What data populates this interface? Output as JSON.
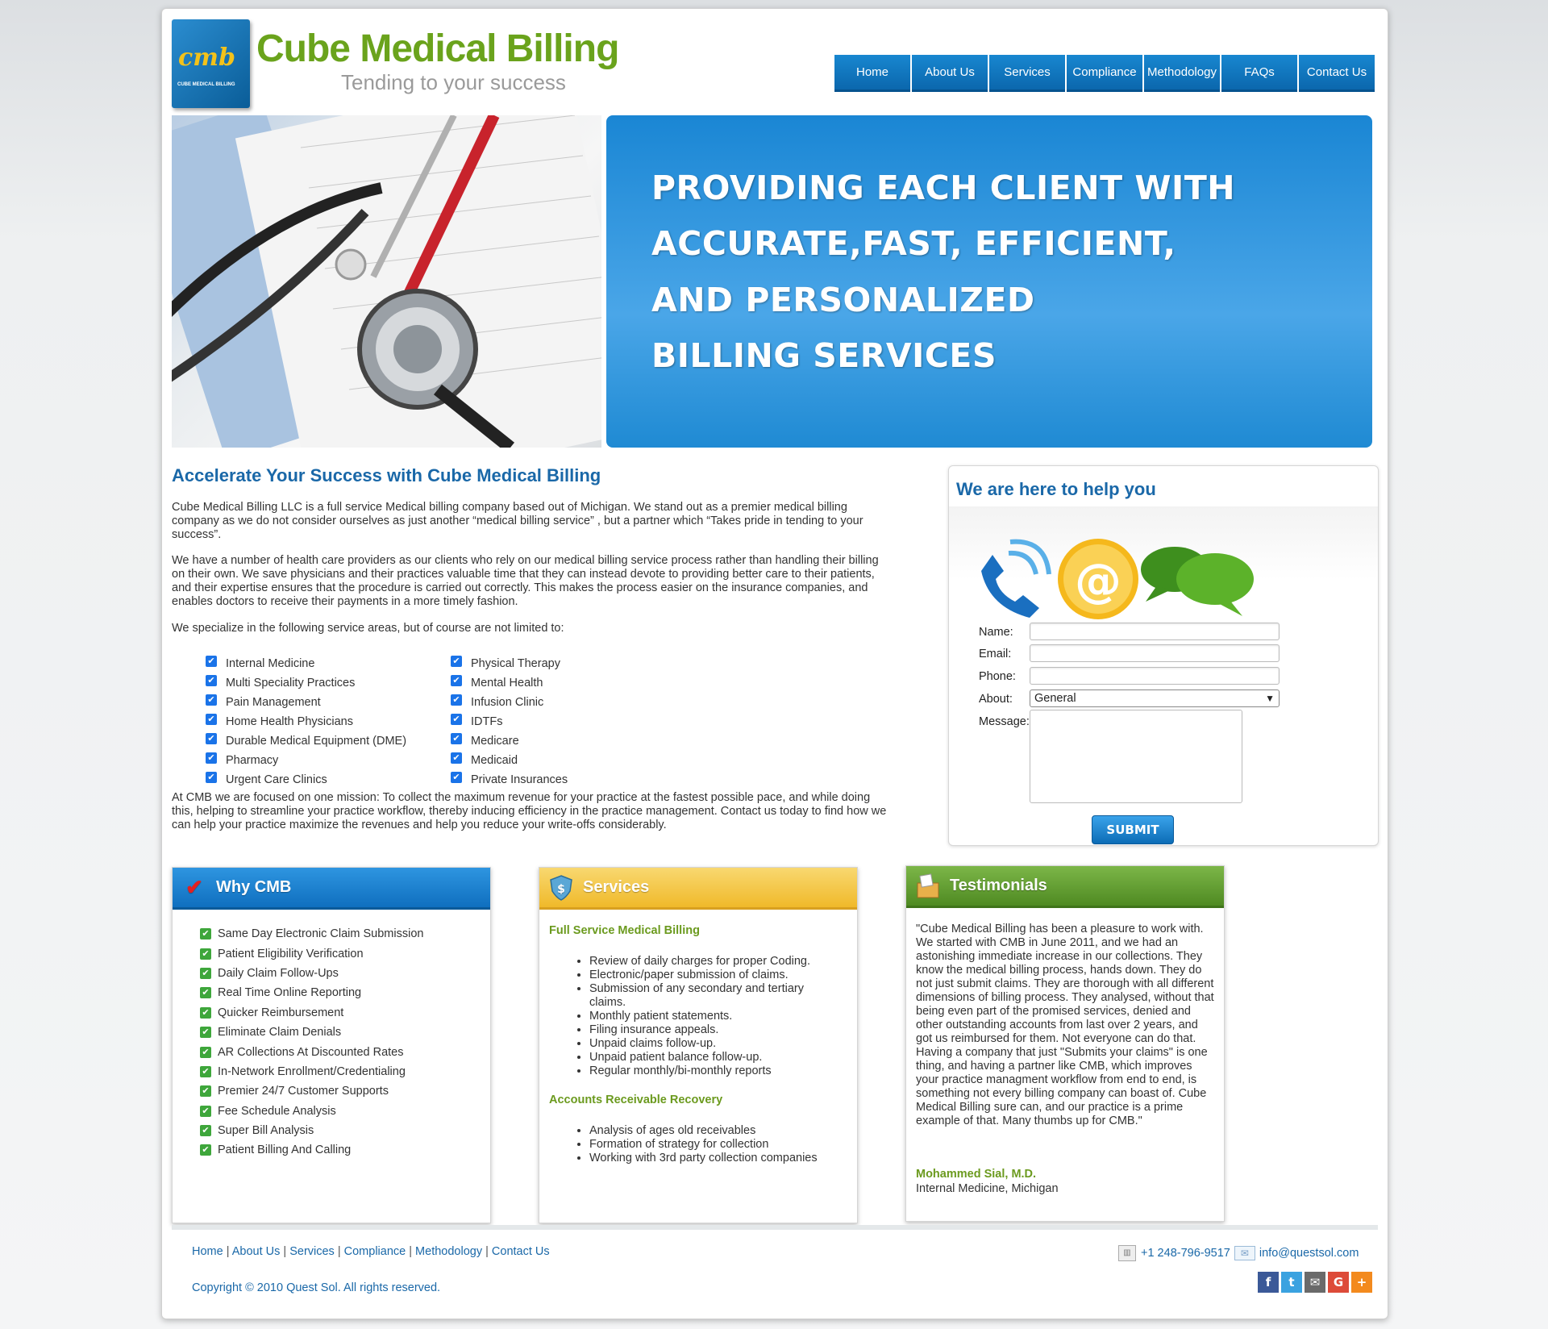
{
  "header": {
    "logo_text": "cmb",
    "logo_subtext": "CUBE MEDICAL BILLING",
    "brand": "Cube Medical Billing",
    "tagline": "Tending to your success"
  },
  "nav": [
    "Home",
    "About Us",
    "Services",
    "Compliance",
    "Methodology",
    "FAQs",
    "Contact Us"
  ],
  "hero": {
    "lines": [
      "PROVIDING EACH CLIENT WITH",
      "ACCURATE,FAST, EFFICIENT,",
      "AND PERSONALIZED",
      "BILLING SERVICES"
    ]
  },
  "main": {
    "title": "Accelerate Your Success with Cube Medical Billing",
    "p1": "Cube Medical Billing LLC is a full service Medical billing company based out of Michigan. We stand out as a premier medical billing company as we do not consider ourselves as just another “medical billing service” , but a partner which “Takes pride in tending to your success”.",
    "p2": "We have a number of health care providers as our clients who rely on our medical billing service process rather than handling their billing on their own. We save physicians and their practices valuable time that they can instead devote to providing better care to their patients, and their expertise ensures that the procedure is carried out correctly. This makes the process easier on the insurance companies, and enables doctors to receive their payments in a more timely fashion.",
    "p3": "We specialize in the following service areas, but of course are not limited to:",
    "areas_left": [
      "Internal Medicine",
      "Multi Speciality Practices",
      "Pain Management",
      "Home Health Physicians",
      "Durable Medical Equipment (DME)",
      "Pharmacy",
      "Urgent Care Clinics"
    ],
    "areas_right": [
      "Physical Therapy",
      "Mental Health",
      "Infusion Clinic",
      "IDTFs",
      "Medicare",
      "Medicaid",
      "Private Insurances"
    ],
    "p4": "At CMB we are focused on one mission: To collect the maximum revenue for your practice at the fastest possible pace, and while doing this, helping to streamline your practice workflow, thereby inducing efficiency in the practice management. Contact us today to find how we can help your practice maximize the revenues and help you reduce your write-offs considerably."
  },
  "contact": {
    "title": "We are here to help you",
    "name_label": "Name:",
    "email_label": "Email:",
    "phone_label": "Phone:",
    "about_label": "About:",
    "about_value": "General",
    "message_label": "Message:",
    "submit": "SUBMIT"
  },
  "why": {
    "title": "Why CMB",
    "items": [
      "Same Day Electronic Claim Submission",
      "Patient Eligibility Verification",
      "Daily Claim Follow-Ups",
      "Real Time Online Reporting",
      "Quicker Reimbursement",
      "Eliminate Claim Denials",
      "AR Collections At Discounted Rates",
      "In-Network Enrollment/Credentialing",
      "Premier 24/7 Customer Supports",
      "Fee Schedule Analysis",
      "Super Bill Analysis",
      "Patient Billing And Calling"
    ]
  },
  "services": {
    "title": "Services",
    "h1": "Full Service Medical Billing",
    "list1": [
      "Review of daily charges for proper Coding.",
      "Electronic/paper submission of claims.",
      "Submission of any secondary and tertiary claims.",
      "Monthly patient statements.",
      "Filing insurance appeals.",
      "Unpaid claims follow-up.",
      "Unpaid patient balance follow-up.",
      "Regular monthly/bi-monthly reports"
    ],
    "h2": "Accounts Receivable Recovery",
    "list2": [
      "Analysis of ages old receivables",
      "Formation of strategy for collection",
      "Working with 3rd party collection companies"
    ]
  },
  "testimonials": {
    "title": "Testimonials",
    "text": "\"Cube Medical Billing has been a pleasure to work with. We started with CMB in June 2011, and we had an astonishing immediate increase in our collections. They know the medical billing process, hands down. They do not just submit claims. They are thorough with all different dimensions of billing process. They analysed, without that being even part of the promised services, denied and other outstanding accounts from last over 2 years, and got us reimbursed for them. Not everyone can do that. Having a company that just \"Submits your claims\" is one thing, and having a partner like CMB, which improves your practice managment workflow from end to end, is something not every billing company can boast of. Cube Medical Billing sure can, and our practice is a prime example of that. Many thumbs up for CMB.\"",
    "author": "Mohammed Sial, M.D.",
    "author_role": "Internal Medicine, Michigan"
  },
  "footer": {
    "links": [
      "Home",
      "About Us",
      "Services",
      "Compliance",
      "Methodology",
      "Contact Us"
    ],
    "copyright": "Copyright © 2010 Quest Sol. All rights reserved.",
    "phone": "+1 248-796-9517",
    "email": "info@questsol.com",
    "social": [
      "facebook-icon",
      "twitter-icon",
      "email-icon",
      "google-plus-icon",
      "share-plus-icon"
    ]
  },
  "colors": {
    "brand_green": "#6aa31c",
    "nav_blue": "#0b67ad",
    "title_blue": "#1a68a8",
    "why_header": "#1a7fd0",
    "services_header": "#f2c12e",
    "testimonials_header": "#5f9a2c"
  }
}
